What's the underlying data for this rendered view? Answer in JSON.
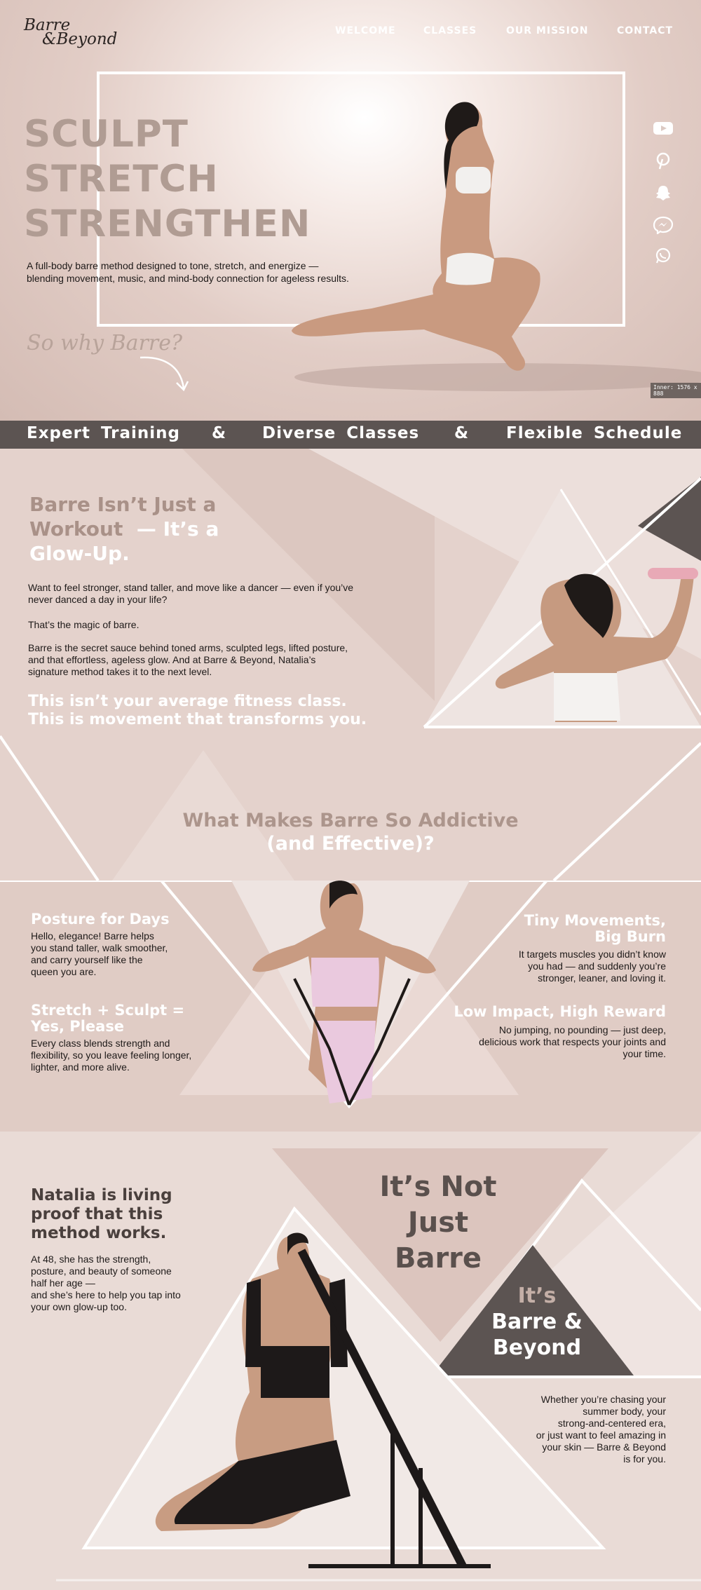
{
  "brand": {
    "logo_line1": "Barre",
    "logo_line2": "&Beyond"
  },
  "nav": {
    "welcome": "WELCOME",
    "classes": "CLASSES",
    "mission": "OUR MISSION",
    "contact": "CONTACT"
  },
  "hero": {
    "line1": "SCULPT",
    "line2": "STRETCH",
    "line3": "STRENGTHEN",
    "sub_line1": "A full-body barre method designed to tone, stretch, and energize —",
    "sub_line2": "blending movement, music, and mind-body connection for ageless results.",
    "why": "So why Barre?",
    "badge": "Inner: 1576 x 888"
  },
  "social": [
    "youtube-icon",
    "pinterest-icon",
    "snapchat-icon",
    "messenger-icon",
    "whatsapp-icon"
  ],
  "banner": {
    "item1": "Expert Training",
    "sep1": "&",
    "item2": "Diverse Classes",
    "sep2": "&",
    "item3": "Flexible Schedule"
  },
  "glow": {
    "title_line1": "Barre Isn’t Just a",
    "title_line2a": "Workout",
    "title_line2b": "— It’s a",
    "title_line3": "Glow-Up.",
    "p1_line1": "Want to feel stronger, stand taller, and move like a dancer — even if you’ve",
    "p1_line2": "never danced a day in your life?",
    "p2": "That’s the magic of barre.",
    "p3_line1": "Barre is the secret sauce behind toned arms, sculpted legs, lifted posture,",
    "p3_line2": "and that effortless, ageless glow. And at Barre & Beyond, Natalia’s",
    "p3_line3": "signature method takes it to the next level.",
    "cta_line1": "This isn’t your average fitness class.",
    "cta_line2": "This is movement that transforms you."
  },
  "addictive": {
    "line1": "What Makes Barre So Addictive",
    "line2": "(and Effective)?"
  },
  "features": {
    "posture_title": "Posture for Days",
    "posture_l1": "Hello, elegance! Barre helps",
    "posture_l2": "you stand taller, walk smoother,",
    "posture_l3": "and carry yourself like the",
    "posture_l4": "queen you are.",
    "stretch_title1": "Stretch + Sculpt =",
    "stretch_title2": "Yes, Please",
    "stretch_l1": "Every class blends strength and",
    "stretch_l2": "flexibility, so you leave feeling longer,",
    "stretch_l3": "lighter, and more alive.",
    "tiny_title1": "Tiny Movements,",
    "tiny_title2": "Big Burn",
    "tiny_l1": "It targets muscles you didn’t know",
    "tiny_l2": "you had — and suddenly you’re",
    "tiny_l3": "stronger, leaner, and loving it.",
    "low_title": "Low Impact, High Reward",
    "low_l1": "No jumping, no pounding — just deep,",
    "low_l2": "delicious work that respects your joints and",
    "low_l3": "your time."
  },
  "natalia": {
    "title_l1": "Natalia is living",
    "title_l2": "proof that this",
    "title_l3": "method works.",
    "body_l1": "At 48, she has the strength,",
    "body_l2": "posture, and beauty of someone",
    "body_l3": "half her age —",
    "body_l4": "and she’s here to help you tap into",
    "body_l5": "your own glow-up too.",
    "nj_l1": "It’s Not",
    "nj_l2": "Just",
    "nj_l3": "Barre",
    "its": "It’s",
    "bb_l1": "Barre &",
    "bb_l2": "Beyond",
    "w_l1": "Whether you’re chasing your",
    "w_l2": "summer body, your",
    "w_l3": "strong-and-centered era,",
    "w_l4": "or just want to feel amazing in",
    "w_l5": "your skin — Barre & Beyond",
    "w_l6": "is for you."
  },
  "colors": {
    "dark_band": "#5c5452",
    "accent_taupe": "#b09c93",
    "section_bg": "#e4d2cc"
  }
}
